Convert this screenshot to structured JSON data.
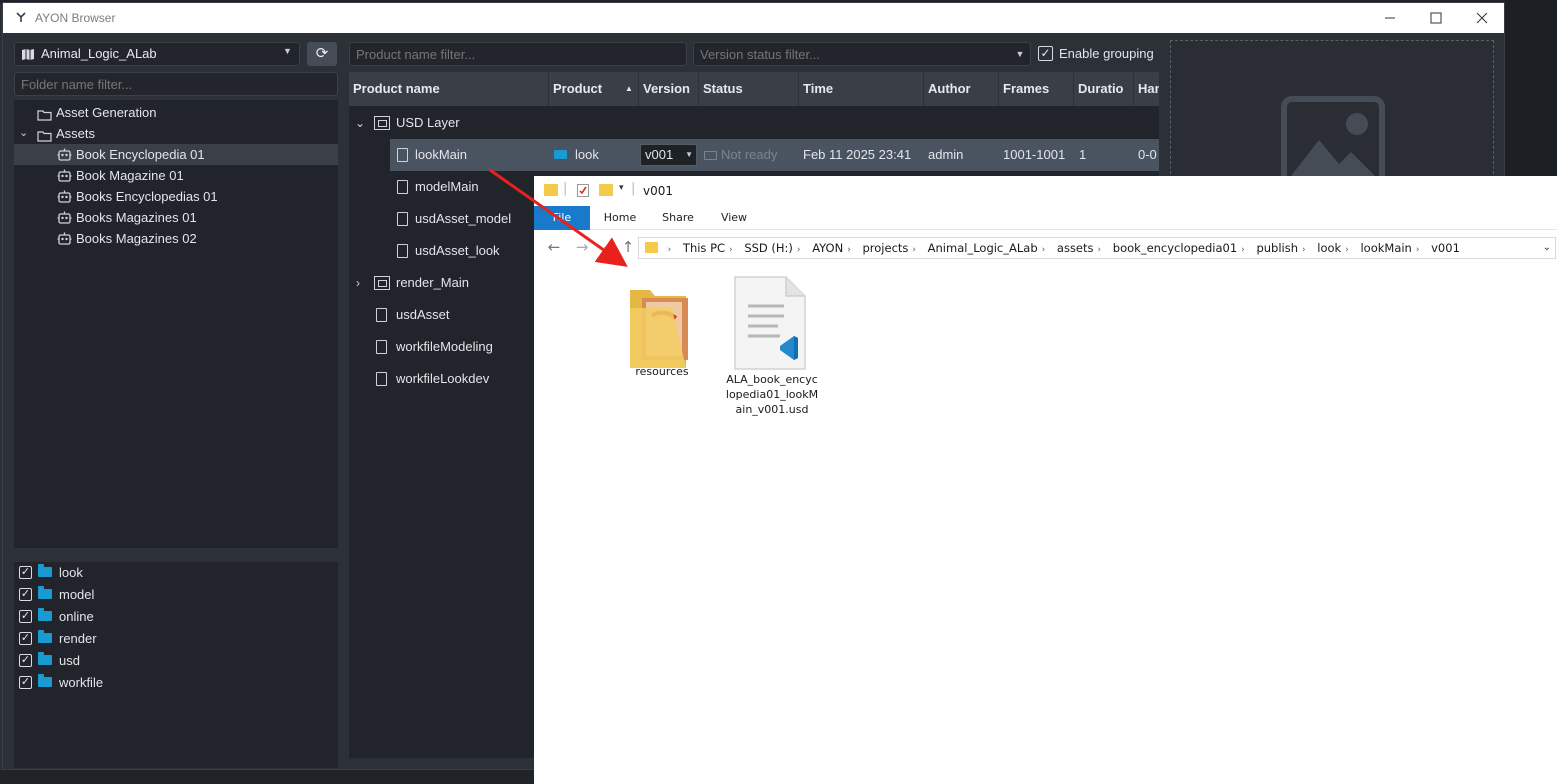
{
  "window": {
    "title": "AYON Browser"
  },
  "left": {
    "project": "Animal_Logic_ALab",
    "folder_filter_placeholder": "Folder name filter...",
    "tree": [
      {
        "label": "Asset Generation",
        "kind": "folder",
        "indent": 0
      },
      {
        "label": "Assets",
        "kind": "folder",
        "indent": 0,
        "expanded": true
      },
      {
        "label": "Book Encyclopedia 01",
        "kind": "asset",
        "indent": 1,
        "selected": true
      },
      {
        "label": "Book Magazine 01",
        "kind": "asset",
        "indent": 1
      },
      {
        "label": "Books Encyclopedias 01",
        "kind": "asset",
        "indent": 1
      },
      {
        "label": "Books Magazines 01",
        "kind": "asset",
        "indent": 1
      },
      {
        "label": "Books Magazines 02",
        "kind": "asset",
        "indent": 1
      }
    ],
    "types": [
      {
        "label": "look",
        "checked": true
      },
      {
        "label": "model",
        "checked": true
      },
      {
        "label": "online",
        "checked": true
      },
      {
        "label": "render",
        "checked": true
      },
      {
        "label": "usd",
        "checked": true
      },
      {
        "label": "workfile",
        "checked": true
      }
    ]
  },
  "products": {
    "name_filter_placeholder": "Product name filter...",
    "status_filter_placeholder": "Version status filter...",
    "grouping_label": "Enable grouping",
    "grouping_checked": true,
    "columns": [
      "Product name",
      "Product",
      "Version",
      "Status",
      "Time",
      "Author",
      "Frames",
      "Duratio",
      "Han"
    ],
    "rows": [
      {
        "name": "USD Layer",
        "type": "group",
        "expanded": true
      },
      {
        "name": "lookMain",
        "type": "item",
        "indent": 1,
        "selected": true,
        "product": "look",
        "version": "v001",
        "status": "Not ready",
        "time": "Feb 11 2025 23:41",
        "author": "admin",
        "frames": "1001-1001",
        "duration": "1",
        "handles": "0-0"
      },
      {
        "name": "modelMain",
        "type": "item",
        "indent": 1
      },
      {
        "name": "usdAsset_model",
        "type": "item",
        "indent": 1
      },
      {
        "name": "usdAsset_look",
        "type": "item",
        "indent": 1
      },
      {
        "name": "render_Main",
        "type": "group",
        "expanded": false
      },
      {
        "name": "usdAsset",
        "type": "item",
        "indent": 0
      },
      {
        "name": "workfileModeling",
        "type": "item",
        "indent": 0
      },
      {
        "name": "workfileLookdev",
        "type": "item",
        "indent": 0
      }
    ]
  },
  "explorer": {
    "title": "v001",
    "tabs": [
      "File",
      "Home",
      "Share",
      "View"
    ],
    "breadcrumb": [
      "This PC",
      "SSD (H:)",
      "AYON",
      "projects",
      "Animal_Logic_ALab",
      "assets",
      "book_encyclopedia01",
      "publish",
      "look",
      "lookMain",
      "v001"
    ],
    "items": [
      {
        "label": "resources",
        "kind": "folder"
      },
      {
        "label": "ALA_book_encyclopedia01_lookMain_v001.usd",
        "label_lines": [
          "ALA_book_encyc",
          "lopedia01_lookM",
          "ain_v001.usd"
        ],
        "kind": "usd-file"
      }
    ]
  },
  "colors": {
    "accent": "#1a9ad2",
    "selection": "#4a5461",
    "arrow": "#e8211c",
    "file_tab": "#1979ca"
  }
}
